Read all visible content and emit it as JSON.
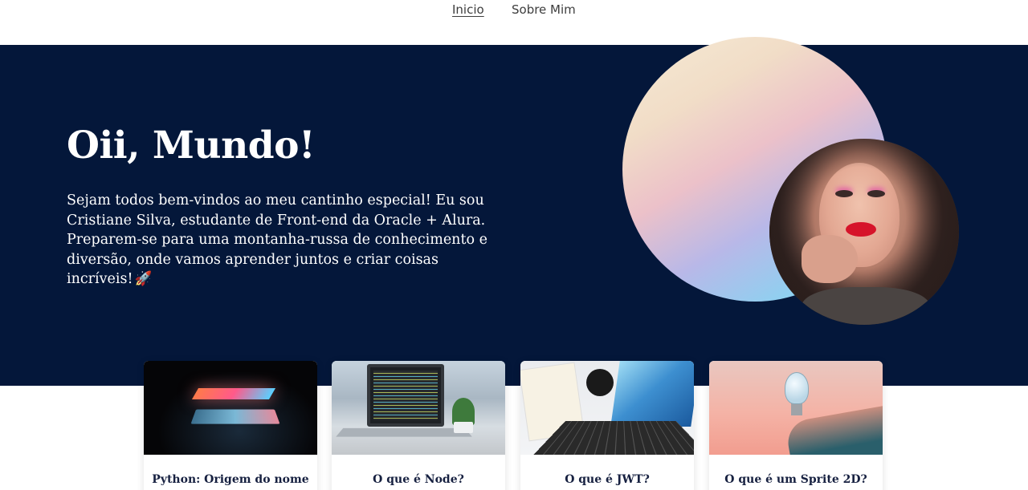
{
  "nav": {
    "links": [
      {
        "label": "Inicio",
        "active": true
      },
      {
        "label": "Sobre Mim",
        "active": false
      }
    ]
  },
  "hero": {
    "title": "Oii, Mundo!",
    "text": "Sejam todos bem-vindos ao meu cantinho especial! Eu sou Cristiane Silva, estudante de Front-end da Oracle + Alura. Preparem-se para uma montanha-russa de conhecimento e diversão, onde vamos aprender juntos e criar coisas incríveis!",
    "emoji": "🚀",
    "background_color": "#04173a"
  },
  "cards": [
    {
      "title": "Python: Origem do nome"
    },
    {
      "title": "O que é Node?"
    },
    {
      "title": "O que é JWT?"
    },
    {
      "title": "O que é um Sprite 2D?"
    }
  ]
}
